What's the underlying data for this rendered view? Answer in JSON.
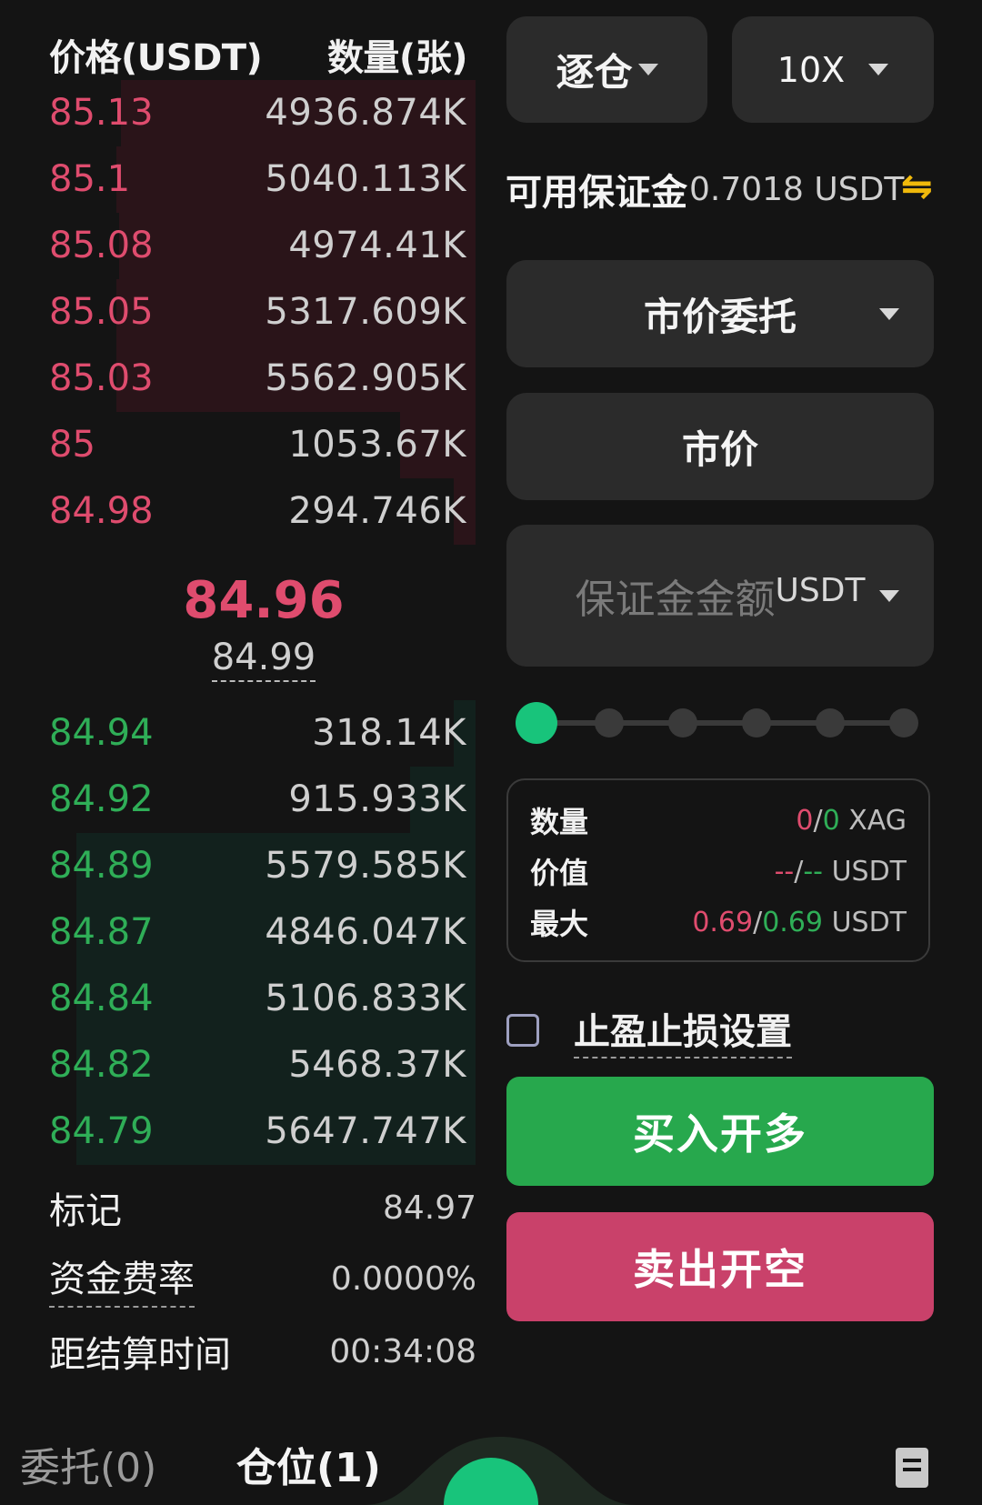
{
  "orderbook": {
    "header": {
      "price_label": "价格(USDT)",
      "qty_label": "数量(张)"
    },
    "asks": [
      {
        "price": "85.13",
        "qty": "4936.874K"
      },
      {
        "price": "85.1",
        "qty": "5040.113K"
      },
      {
        "price": "85.08",
        "qty": "4974.41K"
      },
      {
        "price": "85.05",
        "qty": "5317.609K"
      },
      {
        "price": "85.03",
        "qty": "5562.905K"
      },
      {
        "price": "85",
        "qty": "1053.67K"
      },
      {
        "price": "84.98",
        "qty": "294.746K"
      }
    ],
    "last_price": "84.96",
    "mark_price_small": "84.99",
    "bids": [
      {
        "price": "84.94",
        "qty": "318.14K"
      },
      {
        "price": "84.92",
        "qty": "915.933K"
      },
      {
        "price": "84.89",
        "qty": "5579.585K"
      },
      {
        "price": "84.87",
        "qty": "4846.047K"
      },
      {
        "price": "84.84",
        "qty": "5106.833K"
      },
      {
        "price": "84.82",
        "qty": "5468.37K"
      },
      {
        "price": "84.79",
        "qty": "5647.747K"
      }
    ],
    "info": {
      "mark_label": "标记",
      "mark_value": "84.97",
      "funding_label": "资金费率",
      "funding_value": "0.0000%",
      "settle_label": "距结算时间",
      "settle_value": "00:34:08"
    }
  },
  "order_form": {
    "margin_mode": "逐仓",
    "leverage": "10X",
    "available_label": "可用保证金",
    "available_value": "0.7018 USDT",
    "swap_icon": "⇋",
    "order_type": "市价委托",
    "price_field": "市价",
    "amount_placeholder": "保证金金额",
    "amount_unit": "USDT",
    "slider_level": 0,
    "summary": {
      "qty_label": "数量",
      "qty_long": "0",
      "qty_short": "0",
      "qty_unit": "XAG",
      "value_label": "价值",
      "value_long": "--",
      "value_short": "--",
      "value_unit": "USDT",
      "max_label": "最大",
      "max_long": "0.69",
      "max_short": "0.69",
      "max_unit": "USDT"
    },
    "tpsl_label": "止盈止损设置",
    "buy_label": "买入开多",
    "sell_label": "卖出开空"
  },
  "bottom_tabs": {
    "orders_label": "委托(0)",
    "positions_label": "仓位(1)"
  },
  "colors": {
    "ask": "#df4c6e",
    "bid": "#2fae57",
    "buy_button": "#27a84d",
    "sell_button": "#c9416a",
    "accent_green": "#18c47b"
  }
}
